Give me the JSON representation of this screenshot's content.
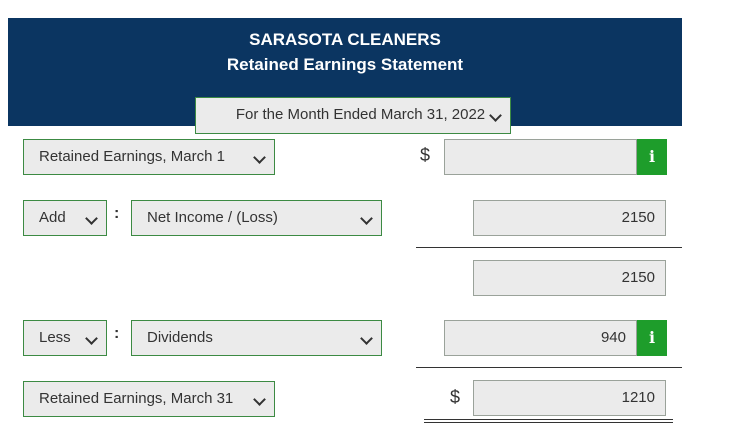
{
  "header": {
    "company": "SARASOTA CLEANERS",
    "title": "Retained Earnings Statement",
    "period": "For the Month Ended March 31, 2022"
  },
  "rows": {
    "beginning": {
      "label": "Retained Earnings, March 1",
      "currency": "$",
      "value": "",
      "info": "i"
    },
    "add": {
      "operator": "Add",
      "separator": ":",
      "label": "Net Income / (Loss)",
      "value": "2150"
    },
    "subtotal": {
      "value": "2150"
    },
    "less": {
      "operator": "Less",
      "separator": ":",
      "label": "Dividends",
      "value": "940",
      "info": "i"
    },
    "ending": {
      "label": "Retained Earnings, March 31",
      "currency": "$",
      "value": "1210"
    }
  },
  "colors": {
    "header_bg": "#0b3561",
    "accent_green": "#1e9d2b",
    "field_bg": "#ebebeb"
  },
  "icons": {
    "info": "info-icon",
    "dropdown": "chevron-down-icon"
  }
}
